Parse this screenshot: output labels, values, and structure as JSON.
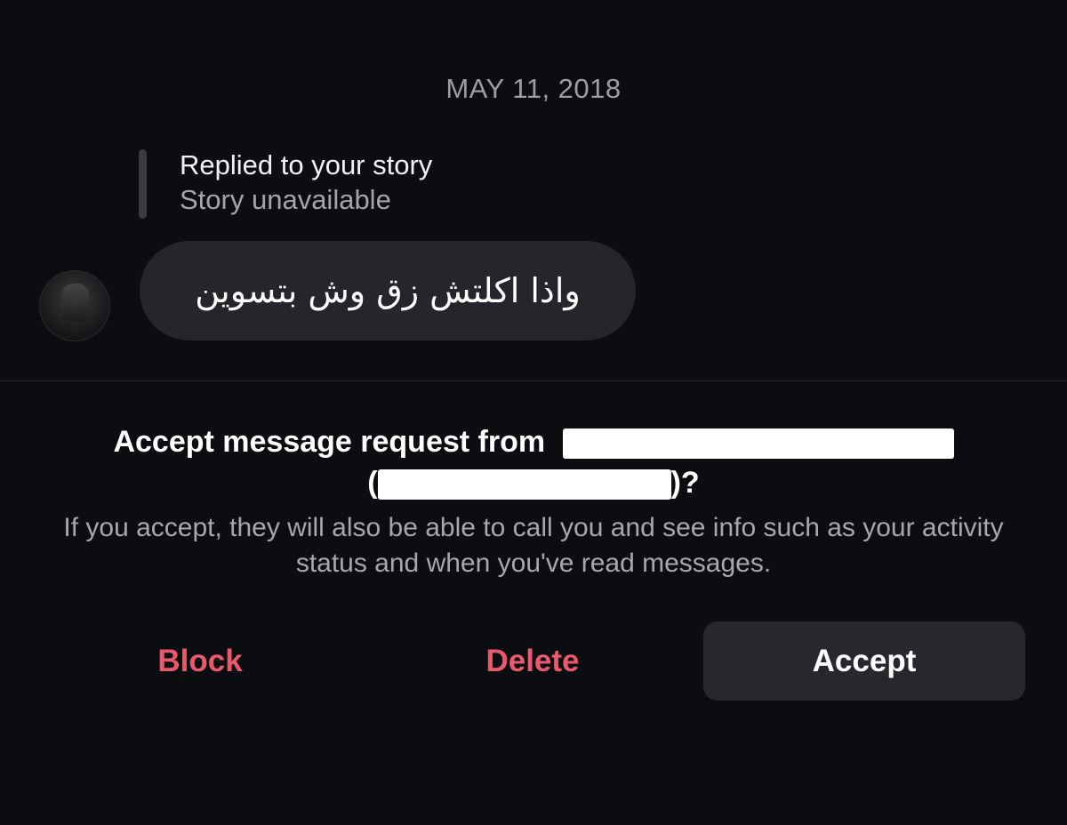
{
  "thread": {
    "date_header": "MAY 11, 2018",
    "story_reply": {
      "title": "Replied to your story",
      "subtitle": "Story unavailable"
    },
    "message": {
      "text": "واذا اكلتش زق وش بتسوين"
    }
  },
  "request": {
    "title_prefix": "Accept message request from",
    "title_open_paren": "(",
    "title_suffix": ")?",
    "description": "If you accept, they will also be able to call you and see info such as your activity status and when you've read messages."
  },
  "actions": {
    "block_label": "Block",
    "delete_label": "Delete",
    "accept_label": "Accept"
  },
  "colors": {
    "background": "#0c0d10",
    "bubble": "#25262b",
    "destructive": "#e8596d",
    "accept_button": "#26282e"
  }
}
